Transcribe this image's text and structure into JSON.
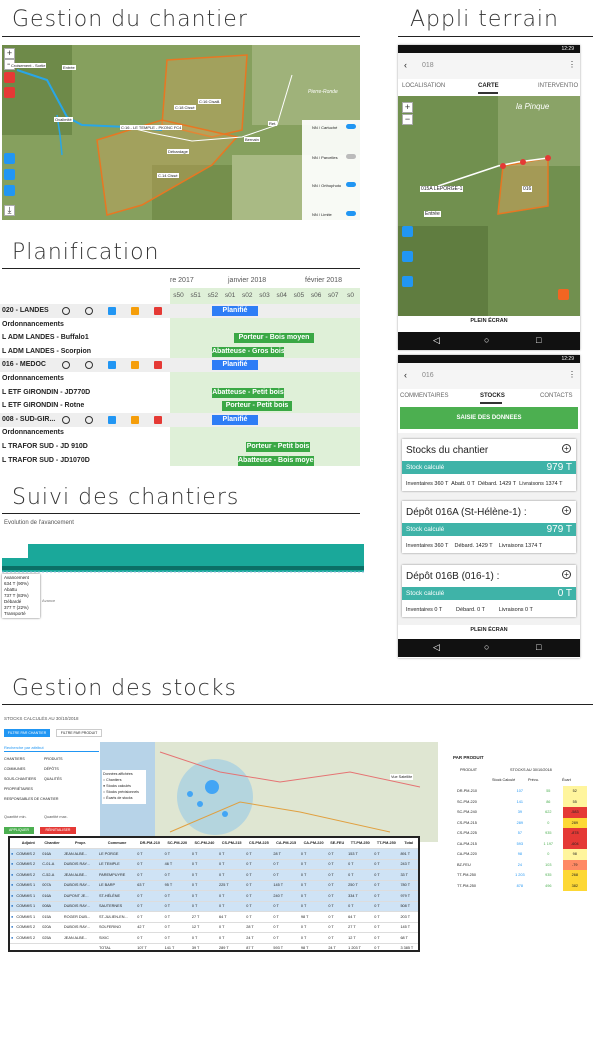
{
  "headings": {
    "gestion_chantier": "Gestion du chantier",
    "appli_terrain": "Appli terrain",
    "planification": "Planification",
    "suivi": "Suivi des chantiers",
    "stocks": "Gestion des stocks"
  },
  "map1": {
    "labels": [
      "Entrée",
      "C:16 Cisaill.",
      "Débardage",
      "Ret.",
      "C.14 Clssé",
      "C:18 Clssé",
      "Bernain",
      "C:16 - LE TEMPLE - PKONC FC4",
      "Ovalimité",
      "Croisement - Sortie"
    ],
    "place": "Pierre-Ronde",
    "layers": [
      {
        "name": "NN / Cartuché",
        "on": true
      },
      {
        "name": "NN / Parcelles",
        "on": false
      },
      {
        "name": "NN / Orthophoto",
        "on": true
      },
      {
        "name": "NN / Limite",
        "on": true
      }
    ]
  },
  "planning": {
    "months": [
      "re 2017",
      "janvier 2018",
      "février 2018"
    ],
    "weeks": [
      "s50",
      "s51",
      "s52",
      "s01",
      "s02",
      "s03",
      "s04",
      "s05",
      "s06",
      "s07",
      "s0"
    ],
    "rows": [
      {
        "name": "020 - LANDES",
        "type": "project",
        "bar": "Planifié"
      },
      {
        "name": "Ordonnancements",
        "type": "sub"
      },
      {
        "name": "L ADM LANDES - Buffalo1",
        "type": "res",
        "bar": "Porteur - Bois moyen"
      },
      {
        "name": "L ADM LANDES - Scorpion",
        "type": "res",
        "bar": "Abatteuse - Gros bois"
      },
      {
        "name": "016 - MEDOC",
        "type": "project",
        "bar": "Planifié"
      },
      {
        "name": "Ordonnancements",
        "type": "sub"
      },
      {
        "name": "L ETF GIRONDIN - JD770D",
        "type": "res",
        "bar": "Abatteuse - Petit bois"
      },
      {
        "name": "L ETF GIRONDIN - Rotne",
        "type": "res",
        "bar": "Porteur - Petit bois"
      },
      {
        "name": "008 - SUD-GIR...",
        "type": "project",
        "bar": "Planifié"
      },
      {
        "name": "Ordonnancements",
        "type": "sub"
      },
      {
        "name": "L TRAFOR SUD - JD 910D",
        "type": "res",
        "bar": "Porteur - Petit bois"
      },
      {
        "name": "L TRAFOR SUD - JD1070D",
        "type": "res",
        "bar": "Abatteuse - Bois moyen"
      }
    ]
  },
  "suivi": {
    "title": "Evolution de l'avancement",
    "tooltip": [
      "Avancement",
      "634 T (90%)",
      "Abattu",
      "737 T (83%)",
      "Débardé",
      "377 T (22%)",
      "Transporté"
    ],
    "axis_left": "Avance",
    "axis_right": "Avantage"
  },
  "phone1": {
    "time": "12:29",
    "title": "018",
    "tabs": [
      "LOCALISATION",
      "CARTE",
      "INTERVENTIO"
    ],
    "place": "la Pinque",
    "labels": [
      "015A LEPORGE-1",
      "Entrée",
      "016"
    ],
    "footer": "PLEIN ÉCRAN"
  },
  "phone2": {
    "time": "12:29",
    "title": "016",
    "tabs": [
      "COMMENTAIRES",
      "STOCKS",
      "CONTACTS"
    ],
    "action": "SAISIE DES DONNEES",
    "footer": "PLEIN ÉCRAN",
    "cards": [
      {
        "title": "Stocks du chantier",
        "label": "Stock calculé",
        "value": "979 T",
        "foot": [
          "Inventaires 360 T",
          "Abatt. 0 T",
          "Débard. 1429 T",
          "Livraisons 1374 T"
        ]
      },
      {
        "title": "Dépôt 016A (St-Hélène-1) :",
        "label": "Stock calculé",
        "value": "979 T",
        "foot": [
          "Inventaires 360 T",
          "Débard. 1429 T",
          "Livraisons 1374 T"
        ]
      },
      {
        "title": "Dépôt 016B (016-1) :",
        "label": "Stock calculé",
        "value": "0 T",
        "foot": [
          "Inventaires 0 T",
          "Débard. 0 T",
          "Livraisons 0 T"
        ]
      }
    ]
  },
  "stocks": {
    "title": "STOCKS CALCULÉS AU 30/10/2018",
    "btn_chantier": "FILTRE PAR CHANTIER",
    "btn_produit": "FILTRE PAR PRODUIT",
    "search": "Recherche par attribut",
    "filters": [
      "CHANTIERS",
      "PRODUITS",
      "COMMUNES",
      "DÉPÔTS",
      "SOUS-CHANTIERS",
      "QUALITÉS",
      "PROPRIÉTAIRES",
      "RESPONSABLES DE CHANTIER"
    ],
    "qty_min": "Quantité min.",
    "qty_max": "Quantité max.",
    "apply": "APPLIQUER",
    "reset": "RÉINITIALISER",
    "legend": [
      "Données affichées",
      "Chantiers",
      "Stocks calculés",
      "Stocks prévisionnels",
      "Écarts de stocks"
    ],
    "cols": [
      "Adjoint",
      "Chantier",
      "Propr.",
      "Commune",
      "DR-PM-210",
      "SC-PM-220",
      "SC-PM-240",
      "CS-PM-215",
      "CS-PM-225",
      "CA-PM-215",
      "CA-PM-220",
      "SE-FEU",
      "TT-PM-250",
      "TT-PM-250",
      "Total"
    ],
    "rows": [
      [
        "COMMIS 2",
        "016A",
        "JEAN ALBE...",
        "LE PORGE",
        "0 T",
        "0 T",
        "0 T",
        "0 T",
        "0 T",
        "28 T",
        "0 T",
        "0 T",
        "153 T",
        "0 T",
        "891 T"
      ],
      [
        "COMMIS 2",
        "C-01-A",
        "DUBOIS RAY...",
        "LE TEMPLE",
        "0 T",
        "46 T",
        "0 T",
        "0 T",
        "0 T",
        "0 T",
        "0 T",
        "0 T",
        "0 T",
        "0 T",
        "243 T"
      ],
      [
        "COMMIS 2",
        "C-52-A",
        "JEAN ALBE...",
        "PAREMPUYRE",
        "0 T",
        "0 T",
        "0 T",
        "0 T",
        "0 T",
        "0 T",
        "0 T",
        "0 T",
        "0 T",
        "0 T",
        "33 T"
      ],
      [
        "COMMIS 1",
        "007A",
        "DUBOIS RAY...",
        "LE BARP",
        "63 T",
        "95 T",
        "0 T",
        "225 T",
        "0 T",
        "145 T",
        "0 T",
        "0 T",
        "250 T",
        "0 T",
        "780 T"
      ],
      [
        "COMMIS 1",
        "016A",
        "DUPONT JE...",
        "ST-HÉLÈNE",
        "0 T",
        "0 T",
        "0 T",
        "0 T",
        "0 T",
        "240 T",
        "0 T",
        "0 T",
        "334 T",
        "0 T",
        "979 T"
      ],
      [
        "COMMIS 1",
        "008A",
        "DUBOIS RAY...",
        "SAUTERNES",
        "0 T",
        "0 T",
        "0 T",
        "0 T",
        "0 T",
        "0 T",
        "0 T",
        "0 T",
        "0 T",
        "0 T",
        "508 T"
      ],
      [
        "COMMIS 1",
        "015A",
        "ROGER DUB...",
        "ST-JULIEN-EN...",
        "0 T",
        "0 T",
        "27 T",
        "64 T",
        "0 T",
        "0 T",
        "98 T",
        "0 T",
        "64 T",
        "0 T",
        "203 T"
      ],
      [
        "COMMIS 2",
        "020A",
        "DUBOIS RAY...",
        "SOLFERINO",
        "42 T",
        "0 T",
        "12 T",
        "0 T",
        "28 T",
        "0 T",
        "0 T",
        "0 T",
        "27 T",
        "0 T",
        "145 T"
      ],
      [
        "COMMIS 2",
        "025A",
        "JEAN ALBE...",
        "SIXIC",
        "0 T",
        "0 T",
        "0 T",
        "0 T",
        "24 T",
        "0 T",
        "0 T",
        "0 T",
        "12 T",
        "0 T",
        "68 T"
      ]
    ],
    "total": [
      "TOTAL",
      "107 T",
      "141 T",
      "39 T",
      "289 T",
      "87 T",
      "593 T",
      "98 T",
      "24 T",
      "1 203 T",
      "0 T",
      "3 385 T"
    ],
    "per_prod_title": "PAR PRODUIT",
    "per_prod_cols": [
      "PRODUIT",
      "STOCKS AU 30/10/2018",
      "Stock Calculé",
      "Prévu.",
      "Écart"
    ],
    "per_prod": [
      [
        "DR-PM-210",
        "107",
        "55",
        "52"
      ],
      [
        "SC-PM-220",
        "141",
        "86",
        "55"
      ],
      [
        "SC-PM-240",
        "39",
        "622",
        "-583"
      ],
      [
        "CS-PM-215",
        "289",
        "0",
        "289"
      ],
      [
        "CS-PM-225",
        "57",
        "935",
        "-878"
      ],
      [
        "CA-PM-215",
        "593",
        "1 197",
        "-604"
      ],
      [
        "CA-PM-220",
        "98",
        "0",
        "98"
      ],
      [
        "BZ-FEU",
        "24",
        "103",
        "-79"
      ],
      [
        "TT-PM-250",
        "1 203",
        "935",
        "268"
      ],
      [
        "TT-PM-250",
        "878",
        "496",
        "382"
      ]
    ],
    "map_btn": "Vue Satellite"
  }
}
